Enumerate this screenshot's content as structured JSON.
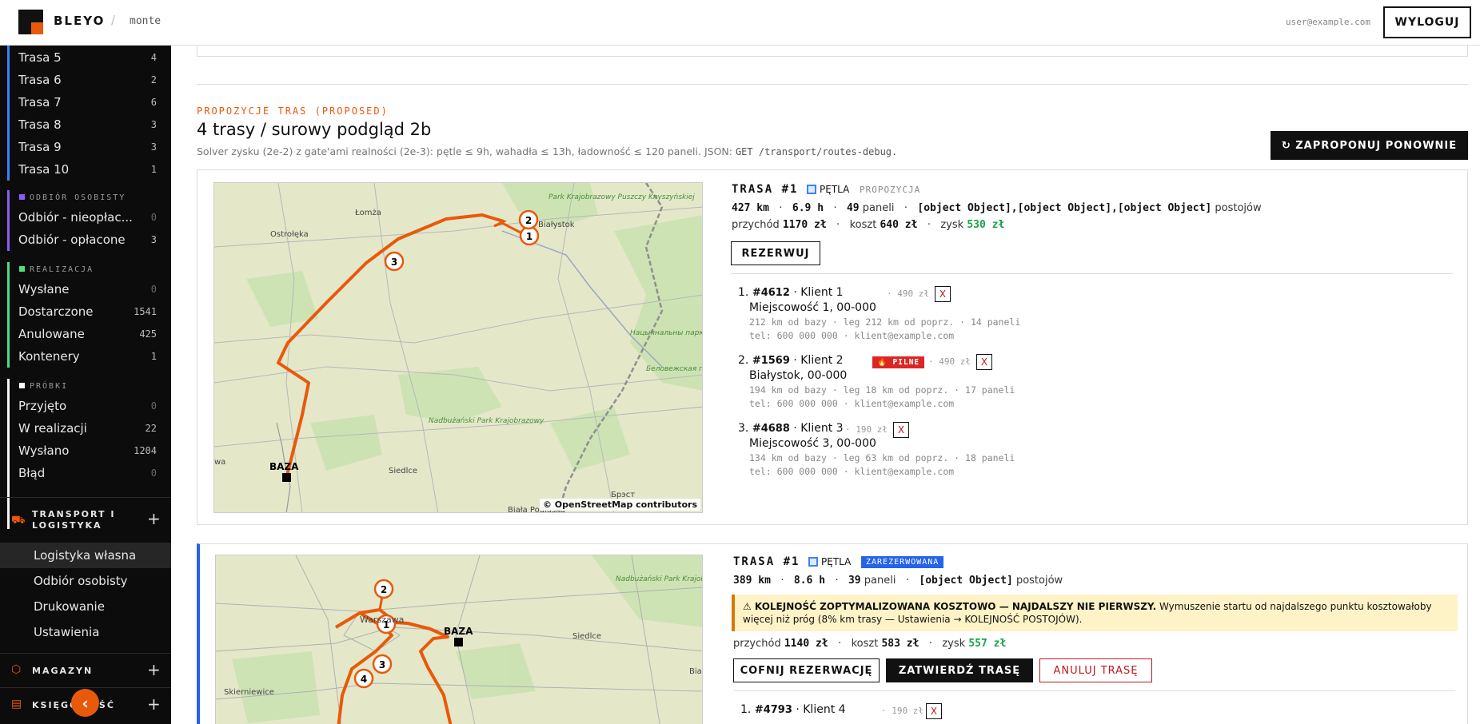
{
  "topbar": {
    "brand": "BLEYO",
    "separator": "/",
    "tenant": "monte",
    "email": "user@example.com",
    "logout": "WYLOGUJ"
  },
  "sidebar": {
    "routes": [
      {
        "label": "Trasa 5",
        "count": "4"
      },
      {
        "label": "Trasa 6",
        "count": "2"
      },
      {
        "label": "Trasa 7",
        "count": "6"
      },
      {
        "label": "Trasa 8",
        "count": "3"
      },
      {
        "label": "Trasa 9",
        "count": "3"
      },
      {
        "label": "Trasa 10",
        "count": "1"
      }
    ],
    "pickup_group": {
      "title": "ODBIÓR OSOBISTY",
      "color": "#8b5cf6",
      "items": [
        {
          "label": "Odbiór - nieopłac...",
          "count": "0"
        },
        {
          "label": "Odbiór - opłacone",
          "count": "3"
        }
      ]
    },
    "realization_group": {
      "title": "REALIZACJA",
      "color": "#4ade80",
      "items": [
        {
          "label": "Wysłane",
          "count": "0"
        },
        {
          "label": "Dostarczone",
          "count": "1541"
        },
        {
          "label": "Anulowane",
          "count": "425"
        },
        {
          "label": "Kontenery",
          "count": "1"
        }
      ]
    },
    "samples_group": {
      "title": "PRÓBKI",
      "color": "#ffffff",
      "items": [
        {
          "label": "Przyjęto",
          "count": "0"
        },
        {
          "label": "W realizacji",
          "count": "22"
        },
        {
          "label": "Wysłano",
          "count": "1204"
        },
        {
          "label": "Błąd",
          "count": "0"
        }
      ]
    },
    "transport": {
      "title_line1": "TRANSPORT I",
      "title_line2": "LOGISTYKA",
      "sub": [
        "Logistyka własna",
        "Odbiór osobisty",
        "Drukowanie",
        "Ustawienia"
      ]
    },
    "warehouse": {
      "title": "MAGAZYN"
    },
    "accounting": {
      "title": "KSIĘGOWOŚĆ"
    },
    "accent": "#e8590c"
  },
  "main": {
    "eyebrow": "PROPOZYCJE TRAS (PROPOSED)",
    "title": "4 trasy / surowy podgląd 2b",
    "subtitle": "Solver zysku (2e-2) z gate'ami realności (2e-3): pętle ≤ 9h, wahadła ≤ 13h, ładowność ≤ 120 paneli. JSON: ",
    "subtitle_code": "GET /transport/routes-debug.",
    "repropose": "↻ ZAPROPONUJ PONOWNIE"
  },
  "route1": {
    "title": "TRASA #1",
    "kind": "PĘTLA",
    "badge": "PROPOZYCJA",
    "km": "427 km",
    "hours": "6.9 h",
    "panels": "49",
    "panels_label": "paneli",
    "stops": [
      {
        "num": "1.",
        "id": "#4612",
        "client": "· Klient 1",
        "price": "· 490 zł",
        "x": "X",
        "addr": "Miejscowość 1, 00-000",
        "meta": "212 km od bazy · leg 212 km od poprz. · 14 paneli",
        "contact": "tel: 600 000 000 · klient@example.com"
      },
      {
        "num": "2.",
        "id": "#1569",
        "client": "· Klient 2",
        "urgent": "🔥 PILNE",
        "price": "· 490 zł",
        "x": "X",
        "addr": "Białystok, 00-000",
        "meta": "194 km od bazy · leg 18 km od poprz. · 17 paneli",
        "contact": "tel: 600 000 000 · klient@example.com"
      },
      {
        "num": "3.",
        "id": "#4688",
        "client": "· Klient 3",
        "price": "· 190 zł",
        "x": "X",
        "addr": "Miejscowość 3, 00-000",
        "meta": "134 km od bazy · leg 63 km od poprz. · 18 paneli",
        "contact": "tel: 600 000 000 · klient@example.com"
      }
    ],
    "stops_label": "postojów",
    "revenue_label": "przychód",
    "revenue": "1170 zł",
    "cost_label": "koszt",
    "cost": "640 zł",
    "profit_label": "zysk",
    "profit": "530 zł",
    "reserve": "REZERWUJ",
    "map": {
      "attribution": "© OpenStreetMap contributors",
      "base": "BAZA",
      "places": [
        "Łomża",
        "Ostrołęka",
        "Białystok",
        "Siedlce",
        "Biała Podlaska",
        "Брэст",
        "Nadbużański Park Krajobrazowy",
        "Park Krajobrazowy Puszczy Knyszyńskiej",
        "Нацыянальны парк «Белавежская пушча»",
        "Беловежская пушча",
        "wa"
      ]
    }
  },
  "route2": {
    "title": "TRASA #1",
    "kind": "PĘTLA",
    "badge": "ZAREZERWOWANA",
    "km": "389 km",
    "hours": "8.6 h",
    "panels": "39",
    "panels_label": "paneli",
    "stops": [
      {
        "num": "1.",
        "id": "#4793",
        "client": "· Klient 4",
        "price": "· 190 zł",
        "x": "X"
      }
    ],
    "stops_label": "postojów",
    "warning_bold": "⚠ KOLEJNOŚĆ ZOPTYMALIZOWANA KOSZTOWO — NAJDALSZY NIE PIERWSZY.",
    "warning_text": " Wymuszenie startu od najdalszego punktu kosztowałoby więcej niż próg (8% km trasy — Ustawienia → KOLEJNOŚĆ POSTOJÓW).",
    "revenue_label": "przychód",
    "revenue": "1140 zł",
    "cost_label": "koszt",
    "cost": "583 zł",
    "profit_label": "zysk",
    "profit": "557 zł",
    "btn_undo": "COFNIJ REZERWACJĘ",
    "btn_confirm": "ZATWIERDŹ TRASĘ",
    "btn_cancel": "ANULUJ TRASĘ",
    "map": {
      "base": "BAZA",
      "places": [
        "Warszawa",
        "Siedlce",
        "Skierniewice",
        "Nadbużański Park Krajobrazowy",
        "Bia"
      ]
    }
  }
}
